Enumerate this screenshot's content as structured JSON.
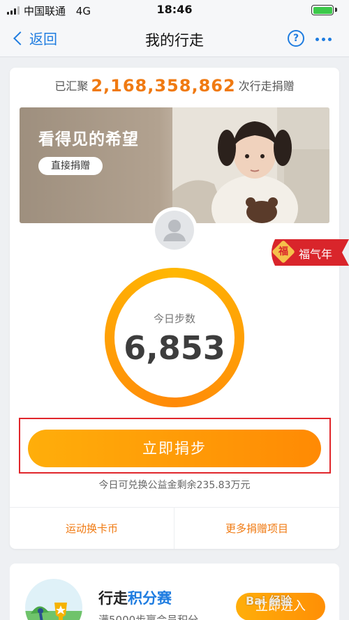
{
  "status_bar": {
    "carrier": "中国联通",
    "network": "4G",
    "time": "18:46",
    "battery_level": 1.0
  },
  "nav": {
    "back_label": "返回",
    "title": "我的行走",
    "help_glyph": "?",
    "icons": [
      "chevron-left-icon",
      "help-icon",
      "more-icon"
    ]
  },
  "summary": {
    "prefix": "已汇聚",
    "total": "2,168,358,862",
    "suffix": "次行走捐赠"
  },
  "banner": {
    "headline": "看得见的希望",
    "donate_label": "直接捐赠"
  },
  "badge": {
    "seal_text": "福",
    "text": "福气年"
  },
  "today": {
    "label": "今日步数",
    "steps": "6,853"
  },
  "cta": {
    "label": "立即捐步"
  },
  "remaining": {
    "text": "今日可兑换公益金剩余235.83万元"
  },
  "links": {
    "left": "运动换卡币",
    "right": "更多捐赠项目"
  },
  "challenge": {
    "title_prefix": "行走",
    "title_highlight": "积分赛",
    "subtitle": "满5000步赢会员积分",
    "enter_label": "立即进入"
  },
  "watermark": "Bai 经验",
  "colors": {
    "accent_blue": "#1e7ce0",
    "accent_orange": "#f07a12",
    "cta_orange": "#ff9a07",
    "highlight_red": "#e0262b"
  }
}
